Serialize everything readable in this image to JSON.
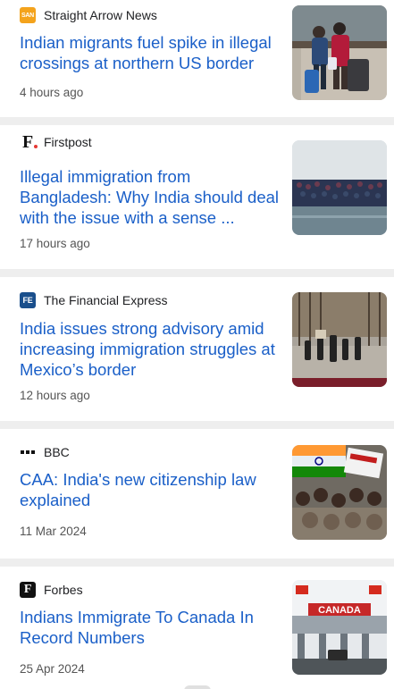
{
  "articles": [
    {
      "source": "Straight Arrow News",
      "logo_text": "SAN",
      "headline": "Indian migrants fuel spike in illegal crossings at northern US border",
      "time": "4 hours ago",
      "thumb_icon": "travelers-with-luggage-image"
    },
    {
      "source": "Firstpost",
      "logo_text": "F",
      "headline": "Illegal immigration from Bangladesh: Why India should deal with the issue with a sense ...",
      "time": "17 hours ago",
      "thumb_icon": "crowd-at-river-image"
    },
    {
      "source": "The Financial Express",
      "logo_text": "FE",
      "headline": "India issues strong advisory amid increasing immigration struggles at Mexico’s border",
      "time": "12 hours ago",
      "thumb_icon": "border-fence-people-image"
    },
    {
      "source": "BBC",
      "logo_text": "",
      "headline": "CAA: India's new citizenship law explained",
      "time": "11 Mar 2024",
      "thumb_icon": "protest-crowd-flags-image"
    },
    {
      "source": "Forbes",
      "logo_text": "F",
      "headline": "Indians Immigrate To Canada In Record Numbers",
      "time": "25 Apr 2024",
      "thumb_icon": "canada-border-crossing-image",
      "thumb_text": "CANADA"
    }
  ],
  "colors": {
    "headline": "#1a5fc8",
    "separator": "#eeeeee",
    "time": "#555555"
  }
}
